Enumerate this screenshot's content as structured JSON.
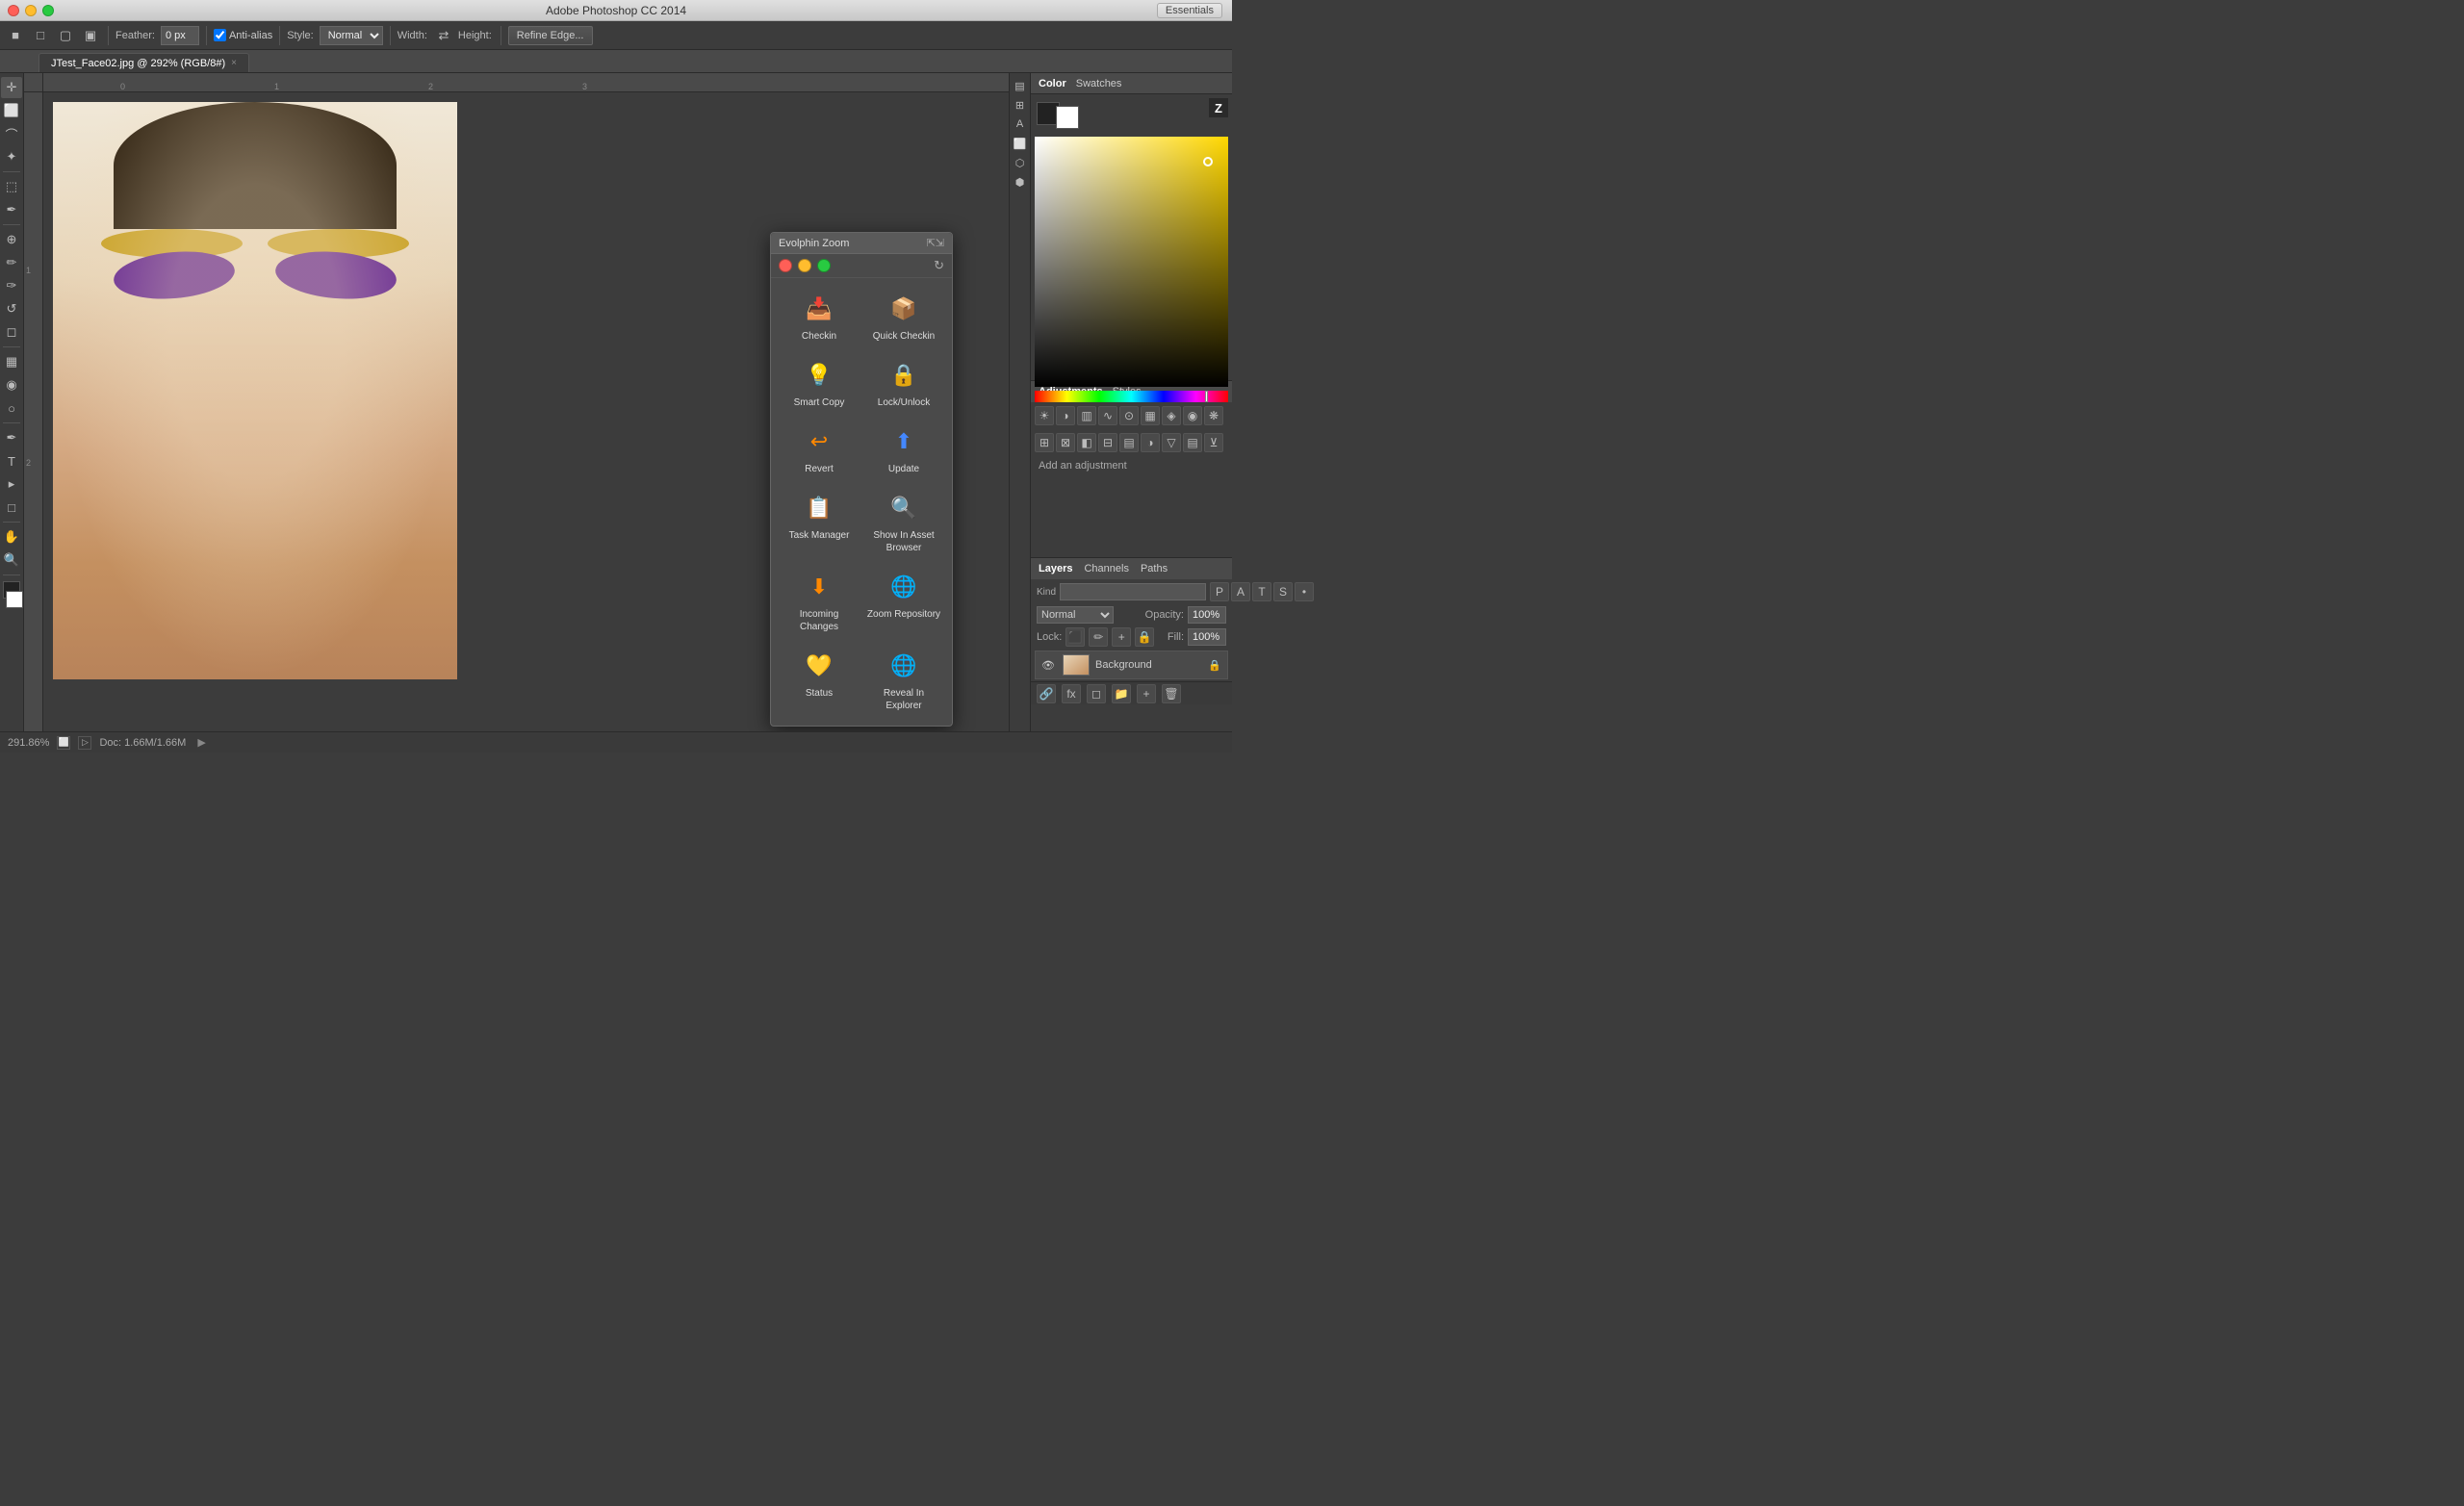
{
  "app": {
    "title": "Adobe Photoshop CC 2014",
    "essentials": "Essentials"
  },
  "window_controls": {
    "close": "close",
    "minimize": "minimize",
    "maximize": "maximize"
  },
  "toolbar": {
    "feather_label": "Feather:",
    "feather_value": "0 px",
    "anti_alias_label": "Anti-alias",
    "style_label": "Style:",
    "style_value": "Normal",
    "width_label": "Width:",
    "height_label": "Height:",
    "refine_edge": "Refine Edge..."
  },
  "tab": {
    "filename": "JTest_Face02.jpg @ 292% (RGB/8#)",
    "close": "×"
  },
  "rulers": {
    "h_ticks": [
      "0",
      "1",
      "2",
      "3"
    ],
    "v_ticks": [
      "1",
      "2"
    ]
  },
  "color_panel": {
    "tab1": "Color",
    "tab2": "Swatches"
  },
  "adjustments_panel": {
    "tab1": "Adjustments",
    "tab2": "Styles",
    "description": "Add an adjustment"
  },
  "layers_panel": {
    "tab1": "Layers",
    "tab2": "Channels",
    "tab3": "Paths",
    "blend_mode": "Normal",
    "opacity_label": "Opacity:",
    "opacity_value": "100%",
    "lock_label": "Lock:",
    "fill_label": "Fill:",
    "fill_value": "100%",
    "layer_name": "Background",
    "kind_label": "Kind"
  },
  "evalphin": {
    "title": "Evolphin Zoom",
    "items": [
      {
        "id": "checkin",
        "label": "Checkin",
        "icon": "📥"
      },
      {
        "id": "quick-checkin",
        "label": "Quick Checkin",
        "icon": "📦"
      },
      {
        "id": "smart-copy",
        "label": "Smart Copy",
        "icon": "💡"
      },
      {
        "id": "lock-unlock",
        "label": "Lock/Unlock",
        "icon": "🔒"
      },
      {
        "id": "revert",
        "label": "Revert",
        "icon": "↩"
      },
      {
        "id": "update",
        "label": "Update",
        "icon": "⬆"
      },
      {
        "id": "task-manager",
        "label": "Task Manager",
        "icon": "📋"
      },
      {
        "id": "show-asset-browser",
        "label": "Show In Asset Browser",
        "icon": "🔍"
      },
      {
        "id": "incoming-changes",
        "label": "Incoming Changes",
        "icon": "⬇"
      },
      {
        "id": "zoom-repository",
        "label": "Zoom Repository",
        "icon": "🌐"
      },
      {
        "id": "status",
        "label": "Status",
        "icon": "💛"
      },
      {
        "id": "reveal-in-explorer",
        "label": "Reveal In Explorer",
        "icon": "🌐"
      }
    ]
  },
  "bottom_bar": {
    "zoom": "291.86%",
    "doc_size": "Doc: 1.66M/1.66M"
  },
  "left_tools": [
    "move",
    "rectangle-select",
    "lasso",
    "wand",
    "crop",
    "eyedropper",
    "healing",
    "brush",
    "clone-stamp",
    "history-brush",
    "eraser",
    "gradient",
    "blur",
    "dodge",
    "pen",
    "type",
    "path-select",
    "shape",
    "hand",
    "zoom"
  ]
}
